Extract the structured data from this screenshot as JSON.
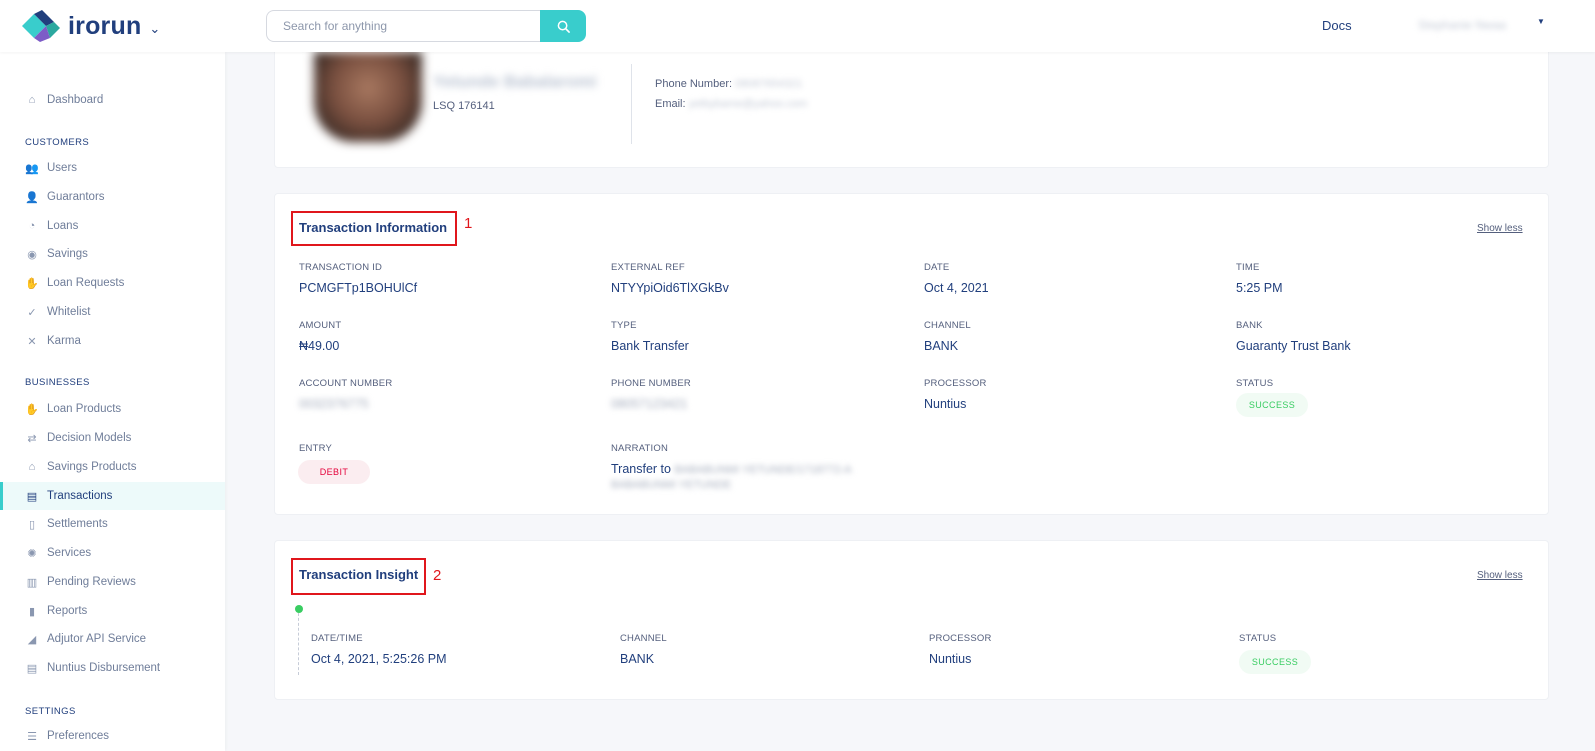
{
  "header": {
    "logo_text": "irorun",
    "search_placeholder": "Search for anything",
    "docs_label": "Docs",
    "user_name": "Stephanie Nwaa"
  },
  "sidebar": {
    "dashboard": "Dashboard",
    "sections": {
      "customers": "CUSTOMERS",
      "businesses": "BUSINESSES",
      "settings": "SETTINGS"
    },
    "customers": [
      "Users",
      "Guarantors",
      "Loans",
      "Savings",
      "Loan Requests",
      "Whitelist",
      "Karma"
    ],
    "businesses": [
      "Loan Products",
      "Decision Models",
      "Savings Products",
      "Transactions",
      "Settlements",
      "Services",
      "Pending Reviews",
      "Reports",
      "Adjutor API Service",
      "Nuntius Disbursement"
    ],
    "settings": [
      "Preferences"
    ],
    "active": "Transactions"
  },
  "profile": {
    "name": "Yetunde Babalaromi",
    "id_code": "LSQ 176141",
    "phone_label": "Phone Number:",
    "phone_value": "08087654321",
    "email_label": "Email:",
    "email_value": "yetbybame@yahoo.com"
  },
  "transaction_info": {
    "title": "Transaction Information",
    "annotation": "1",
    "show_less": "Show less",
    "fields": {
      "transaction_id": {
        "label": "TRANSACTION ID",
        "value": "PCMGFTp1BOHUlCf"
      },
      "external_ref": {
        "label": "EXTERNAL REF",
        "value": "NTYYpiOid6TlXGkBv"
      },
      "date": {
        "label": "DATE",
        "value": "Oct 4, 2021"
      },
      "time": {
        "label": "TIME",
        "value": "5:25 PM"
      },
      "amount": {
        "label": "AMOUNT",
        "value": "₦49.00"
      },
      "type": {
        "label": "TYPE",
        "value": "Bank Transfer"
      },
      "channel": {
        "label": "CHANNEL",
        "value": "BANK"
      },
      "bank": {
        "label": "BANK",
        "value": "Guaranty Trust Bank"
      },
      "account_number": {
        "label": "ACCOUNT NUMBER",
        "value": "0032376775"
      },
      "phone_number": {
        "label": "PHONE NUMBER",
        "value": "08057123421"
      },
      "processor": {
        "label": "PROCESSOR",
        "value": "Nuntius"
      },
      "status": {
        "label": "STATUS",
        "value": "SUCCESS"
      },
      "entry": {
        "label": "ENTRY",
        "value": "DEBIT"
      },
      "narration": {
        "label": "NARRATION",
        "value_prefix": "Transfer to",
        "value_hidden_1": "BABABUNMI YETUNDE/1718772-A",
        "value_hidden_2": "BABABUNMI YETUNDE"
      }
    }
  },
  "transaction_insight": {
    "title": "Transaction Insight",
    "annotation": "2",
    "show_less": "Show less",
    "columns": {
      "datetime": {
        "label": "DATE/TIME",
        "value": "Oct 4, 2021, 5:25:26 PM"
      },
      "channel": {
        "label": "CHANNEL",
        "value": "BANK"
      },
      "processor": {
        "label": "PROCESSOR",
        "value": "Nuntius"
      },
      "status": {
        "label": "STATUS",
        "value": "SUCCESS"
      }
    }
  },
  "colors": {
    "primary": "#213f7d",
    "accent": "#39cdcc",
    "success": "#39cd62",
    "danger": "#e4033b",
    "annotation": "#e0161c"
  }
}
